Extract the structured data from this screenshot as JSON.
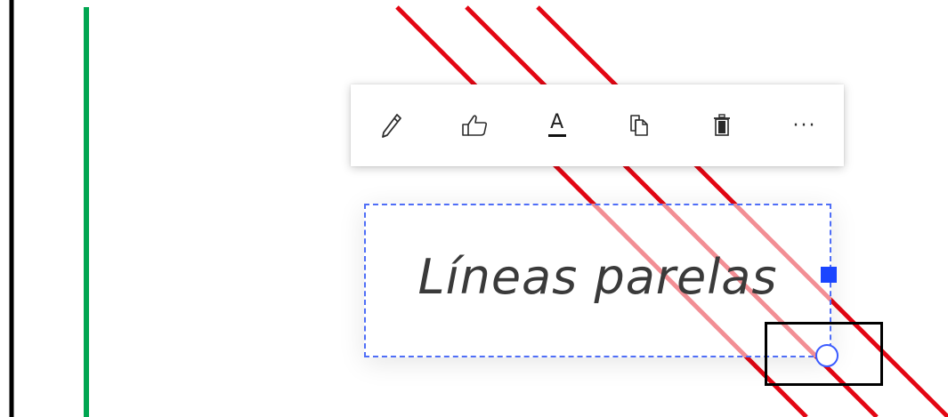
{
  "canvas": {
    "background": "#ffffff",
    "line_colors": {
      "black": "#000000",
      "green": "#00a651",
      "red": "#e30613"
    }
  },
  "toolbar": {
    "buttons": [
      {
        "icon": "pencil-icon",
        "label": ""
      },
      {
        "icon": "thumbs-up-icon",
        "label": ""
      },
      {
        "icon": "font-color-icon",
        "label": "A"
      },
      {
        "icon": "copy-icon",
        "label": ""
      },
      {
        "icon": "trash-icon",
        "label": ""
      },
      {
        "icon": "more-icon",
        "label": "···"
      }
    ]
  },
  "textbox": {
    "text": "Líneas parelas",
    "border_color": "#4f6ef7"
  },
  "handles": {
    "square_color": "#1a45ff",
    "circle_border_color": "#3b5bff"
  }
}
